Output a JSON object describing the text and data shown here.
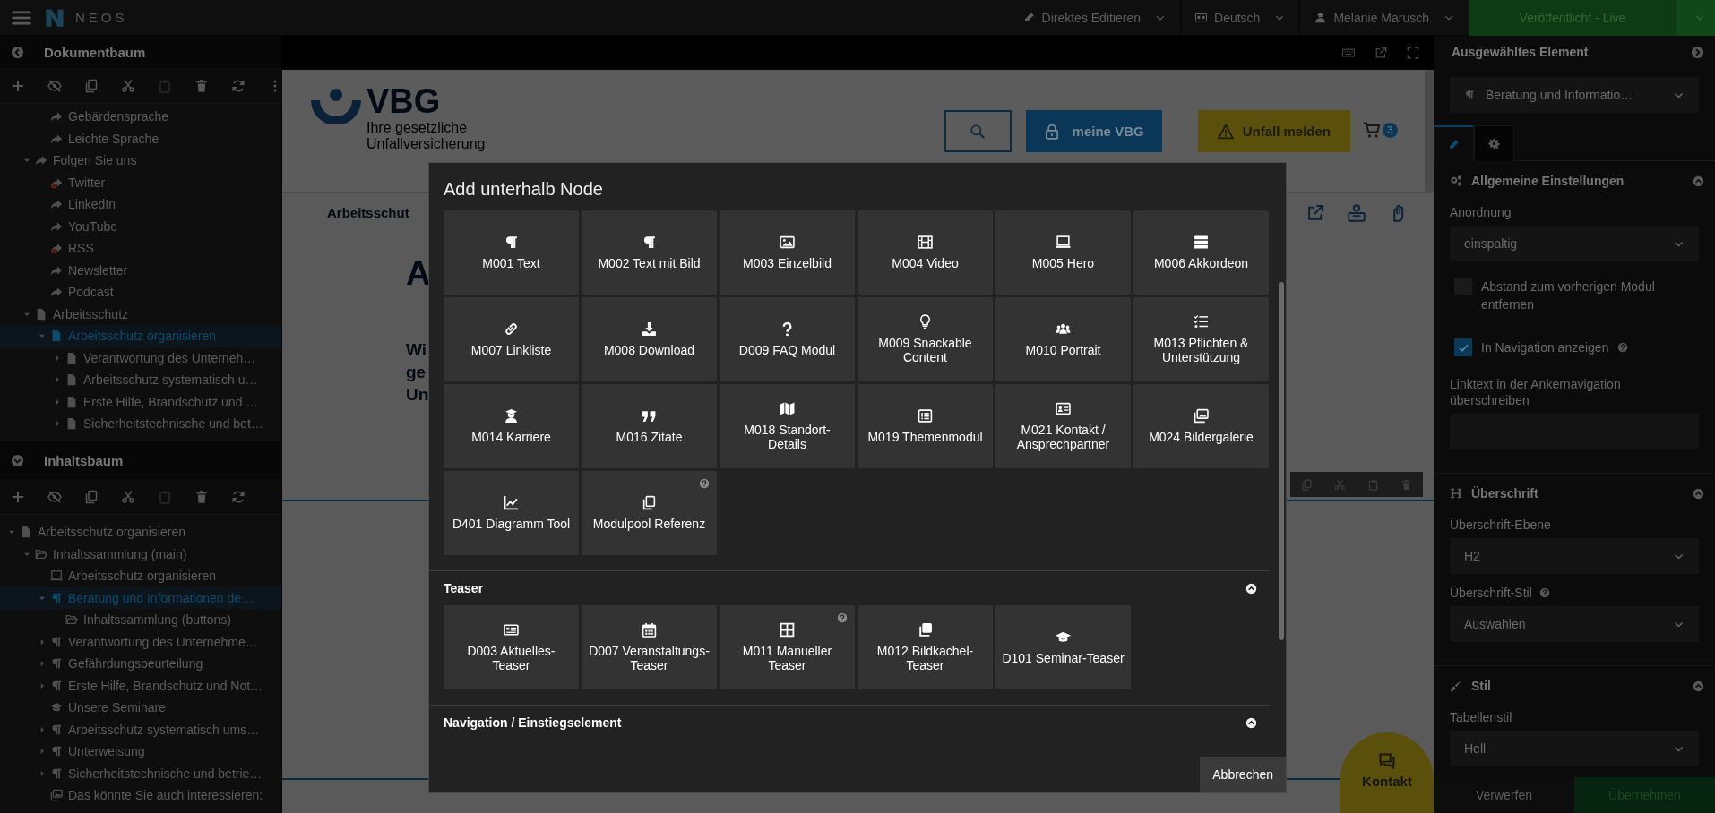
{
  "topbar": {
    "brand": "NEOS",
    "menus": [
      {
        "label": "Direktes Editieren"
      },
      {
        "label": "Deutsch"
      },
      {
        "label": "Melanie Marusch"
      }
    ],
    "publish": {
      "label": "Veröffentlicht - Live"
    }
  },
  "document_tree": {
    "title": "Dokumentbaum",
    "tools": [
      {
        "disabled": false
      },
      {
        "disabled": false
      },
      {
        "disabled": false
      },
      {
        "disabled": false
      },
      {
        "disabled": true
      },
      {
        "disabled": false
      },
      {
        "disabled": false
      },
      {
        "disabled": false
      }
    ],
    "continued": [
      {
        "label": "Gebärdensprache",
        "kind": "shortcut",
        "selected": false
      },
      {
        "label": "Leichte Sprache",
        "kind": "shortcut",
        "selected": false
      }
    ],
    "items": [
      {
        "label": "Folgen Sie uns",
        "kind": "shortcut",
        "expanded": true,
        "selected": false,
        "children": [
          {
            "label": "Twitter",
            "kind": "broken",
            "selected": false
          },
          {
            "label": "LinkedIn",
            "kind": "shortcut",
            "selected": false
          },
          {
            "label": "YouTube",
            "kind": "shortcut",
            "selected": false
          },
          {
            "label": "RSS",
            "kind": "broken",
            "selected": false
          },
          {
            "label": "Newsletter",
            "kind": "shortcut",
            "selected": false
          },
          {
            "label": "Podcast",
            "kind": "shortcut",
            "selected": false
          }
        ]
      },
      {
        "label": "Arbeitsschutz",
        "kind": "page",
        "expanded": true,
        "selected": false,
        "children": [
          {
            "label": "Arbeitsschutz organisieren",
            "kind": "page",
            "expanded": true,
            "selected": true,
            "children": [
              {
                "label": "Verantwortung des Unterneh…",
                "kind": "page",
                "expanded": false,
                "selected": false
              },
              {
                "label": "Arbeitsschutz systematisch u…",
                "kind": "page",
                "expanded": false,
                "selected": false
              },
              {
                "label": "Erste Hilfe, Brandschutz und …",
                "kind": "page",
                "expanded": false,
                "selected": false
              },
              {
                "label": "Sicherheitstechnische und bet…",
                "kind": "page",
                "expanded": false,
                "selected": false
              }
            ]
          }
        ]
      }
    ]
  },
  "content_tree": {
    "title": "Inhaltsbaum",
    "tools": [
      {
        "disabled": false
      },
      {
        "disabled": false
      },
      {
        "disabled": false
      },
      {
        "disabled": false
      },
      {
        "disabled": true
      },
      {
        "disabled": false
      },
      {
        "disabled": false
      }
    ],
    "items": [
      {
        "label": "Arbeitsschutz organisieren",
        "kind": "page",
        "expanded": true,
        "selected": false,
        "children": [
          {
            "label": "Inhaltssammlung (main)",
            "kind": "collection",
            "expanded": true,
            "selected": false,
            "children": [
              {
                "label": "Arbeitsschutz organisieren",
                "kind": "hero",
                "selected": false
              },
              {
                "label": "Beratung und Informationen de…",
                "kind": "text",
                "expanded": true,
                "selected": true,
                "children": [
                  {
                    "label": "Inhaltssammlung (buttons)",
                    "kind": "collection",
                    "selected": false
                  }
                ]
              },
              {
                "label": "Verantwortung des Unternehme…",
                "kind": "text",
                "expanded": false,
                "selected": false
              },
              {
                "label": "Gefährdungsbeurteilung",
                "kind": "text",
                "expanded": false,
                "selected": false
              },
              {
                "label": "Erste Hilfe, Brandschutz und Not…",
                "kind": "text",
                "expanded": false,
                "selected": false
              },
              {
                "label": "Unsere Seminare",
                "kind": "seminar",
                "selected": false
              },
              {
                "label": "Arbeitsschutz systematisch ums…",
                "kind": "text",
                "expanded": false,
                "selected": false
              },
              {
                "label": "Unterweisung",
                "kind": "text",
                "expanded": false,
                "selected": false
              },
              {
                "label": "Sicherheitstechnische und betrie…",
                "kind": "text",
                "expanded": false,
                "selected": false
              },
              {
                "label": "Das könnte Sie auch interessieren:",
                "kind": "gallery",
                "selected": false
              }
            ]
          }
        ]
      }
    ]
  },
  "page": {
    "logo": "VBG",
    "tagline": [
      "Ihre gesetzliche",
      "Unfallversicherung"
    ],
    "account_button": "meine VBG",
    "report_button": "Unfall melden",
    "cart_count": "3",
    "nav_label": "Arbeitsschut",
    "heading": "A",
    "intro_lines": [
      "Wi",
      "ge",
      "Un"
    ],
    "contact": "Kontakt"
  },
  "dialog": {
    "title": "Add unterhalb Node",
    "groups": [
      {
        "items": [
          {
            "label": "M001 Text",
            "kind": "text"
          },
          {
            "label": "M002 Text mit Bild",
            "kind": "text"
          },
          {
            "label": "M003 Einzelbild",
            "kind": "image"
          },
          {
            "label": "M004 Video",
            "kind": "video"
          },
          {
            "label": "M005 Hero",
            "kind": "hero"
          },
          {
            "label": "M006 Akkordeon",
            "kind": "accordion"
          },
          {
            "label": "M007 Linkliste",
            "kind": "link"
          },
          {
            "label": "M008 Download",
            "kind": "download"
          },
          {
            "label": "D009 FAQ Modul",
            "kind": "faq"
          },
          {
            "label": "M009 Snackable Content",
            "kind": "idea"
          },
          {
            "label": "M010 Portrait",
            "kind": "people"
          },
          {
            "label": "M013 Pflichten & Unterstützung",
            "kind": "checklist"
          },
          {
            "label": "M014 Karriere",
            "kind": "career"
          },
          {
            "label": "M016 Zitate",
            "kind": "quote"
          },
          {
            "label": "M018 Standort-Details",
            "kind": "map"
          },
          {
            "label": "M019 Themenmodul",
            "kind": "list"
          },
          {
            "label": "M021 Kontakt / Ansprechpartner",
            "kind": "contact"
          },
          {
            "label": "M024 Bildergalerie",
            "kind": "gallery"
          },
          {
            "label": "D401 Diagramm Tool",
            "kind": "chart"
          },
          {
            "label": "Modulpool Referenz",
            "kind": "reference",
            "help": true
          }
        ]
      },
      {
        "title": "Teaser",
        "expanded": true,
        "items": [
          {
            "label": "D003 Aktuelles-Teaser",
            "kind": "news"
          },
          {
            "label": "D007 Veranstaltungs-Teaser",
            "kind": "event"
          },
          {
            "label": "M011 Manueller Teaser",
            "kind": "grid",
            "help": true
          },
          {
            "label": "M012 Bildkachel-Teaser",
            "kind": "tiles"
          },
          {
            "label": "D101 Seminar-Teaser",
            "kind": "seminar"
          }
        ]
      },
      {
        "title": "Navigation / Einstiegselement",
        "expanded": true
      }
    ],
    "cancel": "Abbrechen"
  },
  "inspector": {
    "title": "Ausgewähltes Element",
    "element": {
      "label": "Beratung und Informatio…",
      "kind": "text"
    },
    "tabs": [
      {
        "selected": true
      },
      {
        "selected": false
      }
    ],
    "sections": [
      {
        "title": "Allgemeine Einstellungen",
        "kind": "general",
        "expanded": true,
        "fields": [
          {
            "kind": "select",
            "label": "Anordnung",
            "value": "einspaltig"
          },
          {
            "kind": "checkbox",
            "label": "Abstand zum vorherigen Modul entfernen",
            "checked": false
          },
          {
            "kind": "checkbox",
            "label": "In Navigation anzeigen",
            "checked": true,
            "help": true
          },
          {
            "kind": "text",
            "label": "Linktext in der Ankernavigation überschreiben"
          }
        ]
      },
      {
        "title": "Überschrift",
        "kind": "heading",
        "expanded": true,
        "fields": [
          {
            "kind": "select",
            "label": "Überschrift-Ebene",
            "value": "H2"
          },
          {
            "kind": "select",
            "label": "Überschrift-Stil",
            "value": "Auswählen",
            "help": true
          }
        ]
      },
      {
        "title": "Stil",
        "kind": "style",
        "expanded": true,
        "fields": [
          {
            "kind": "select",
            "label": "Tabellenstil",
            "value": "Hell"
          }
        ]
      }
    ],
    "discard": "Verwerfen",
    "apply": "Übernehmen"
  }
}
